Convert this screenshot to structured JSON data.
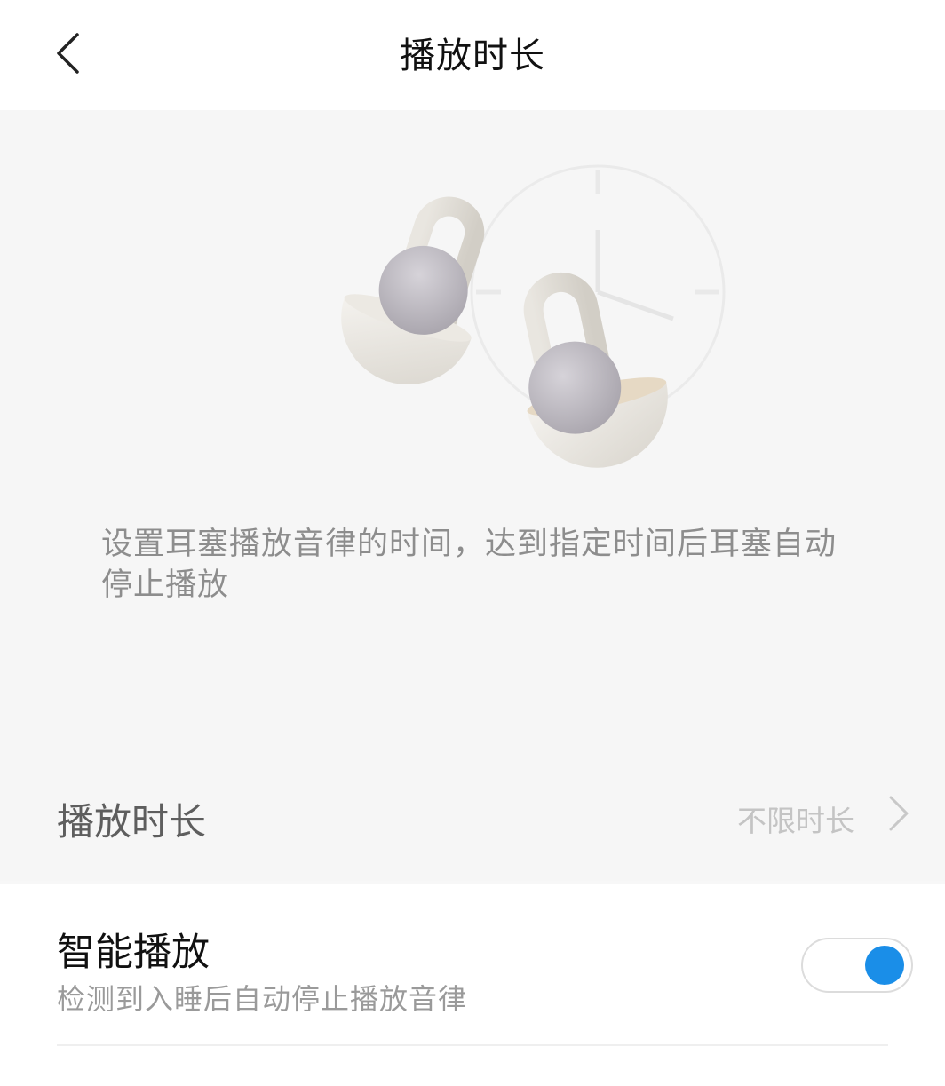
{
  "header": {
    "title": "播放时长",
    "back_icon": "chevron-left-icon"
  },
  "hero": {
    "illustration": "sleep-earbuds-with-clock",
    "description": "设置耳塞播放音律的时间，达到指定时间后耳塞自动停止播放"
  },
  "duration": {
    "label": "播放时长",
    "value": "不限时长",
    "icon": "chevron-right-icon"
  },
  "smart_play": {
    "title": "智能播放",
    "subtitle": "检测到入睡后自动停止播放音律",
    "enabled": true
  },
  "colors": {
    "accent": "#1a8ee8",
    "background": "#f6f6f6",
    "card": "#ffffff"
  }
}
